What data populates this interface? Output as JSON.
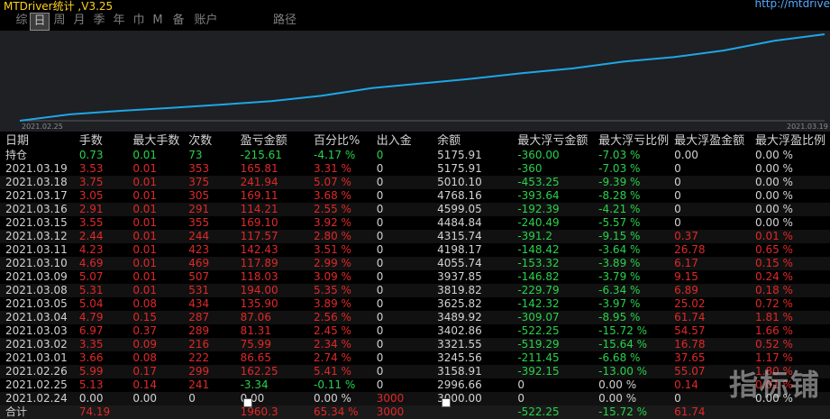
{
  "app": {
    "title": "MTDriver统计 ,V3.25",
    "link": "http://mtdrive"
  },
  "tabs": [
    {
      "label": "综"
    },
    {
      "label": "日",
      "active": true
    },
    {
      "label": "周"
    },
    {
      "label": "月"
    },
    {
      "label": "季"
    },
    {
      "label": "年"
    },
    {
      "label": "巾"
    },
    {
      "label": "M"
    },
    {
      "label": "备"
    },
    {
      "label": "账户"
    },
    {
      "label": "路径"
    }
  ],
  "chart_data": {
    "type": "line",
    "start_label": "2021.02.25",
    "end_label": "2021.03.19",
    "x": [
      "2021.02.25",
      "2021.02.26",
      "2021.03.01",
      "2021.03.02",
      "2021.03.03",
      "2021.03.04",
      "2021.03.05",
      "2021.03.08",
      "2021.03.09",
      "2021.03.10",
      "2021.03.11",
      "2021.03.12",
      "2021.03.15",
      "2021.03.16",
      "2021.03.17",
      "2021.03.18",
      "2021.03.19"
    ],
    "y": [
      2996.66,
      3158.91,
      3245.56,
      3321.55,
      3402.86,
      3489.92,
      3625.82,
      3819.82,
      3937.85,
      4055.74,
      4198.17,
      4315.74,
      4484.84,
      4599.05,
      4768.16,
      5010.1,
      5175.91
    ],
    "line_color": "#1ea6e6"
  },
  "table": {
    "headers": [
      "日期",
      "手数",
      "最大手数",
      "次数",
      "盈亏金额",
      "百分比%",
      "出入金",
      "余额",
      "最大浮亏金额",
      "最大浮亏比例",
      "最大浮盈金额",
      "最大浮盈比例"
    ],
    "position_row": [
      "持仓",
      "0.73",
      "0.01",
      "73",
      "-215.61",
      "-4.17 %",
      "0",
      "5175.91",
      "-360.00",
      "-7.03 %",
      "0.00",
      "0.00 %"
    ],
    "rows": [
      [
        "2021.03.19",
        "3.53",
        "0.01",
        "353",
        "165.81",
        "3.31 %",
        "0",
        "5175.91",
        "-360",
        "-7.03 %",
        "0",
        "0.00 %"
      ],
      [
        "2021.03.18",
        "3.75",
        "0.01",
        "375",
        "241.94",
        "5.07 %",
        "0",
        "5010.10",
        "-453.25",
        "-9.39 %",
        "0",
        "0.00 %"
      ],
      [
        "2021.03.17",
        "3.05",
        "0.01",
        "305",
        "169.11",
        "3.68 %",
        "0",
        "4768.16",
        "-393.64",
        "-8.28 %",
        "0",
        "0.00 %"
      ],
      [
        "2021.03.16",
        "2.91",
        "0.01",
        "291",
        "114.21",
        "2.55 %",
        "0",
        "4599.05",
        "-192.39",
        "-4.21 %",
        "0",
        "0.00 %"
      ],
      [
        "2021.03.15",
        "3.55",
        "0.01",
        "355",
        "169.10",
        "3.92 %",
        "0",
        "4484.84",
        "-240.49",
        "-5.57 %",
        "0",
        "0.00 %"
      ],
      [
        "2021.03.12",
        "2.44",
        "0.01",
        "244",
        "117.57",
        "2.80 %",
        "0",
        "4315.74",
        "-391.2",
        "-9.15 %",
        "0.37",
        "0.01 %"
      ],
      [
        "2021.03.11",
        "4.23",
        "0.01",
        "423",
        "142.43",
        "3.51 %",
        "0",
        "4198.17",
        "-148.42",
        "-3.64 %",
        "26.78",
        "0.65 %"
      ],
      [
        "2021.03.10",
        "4.69",
        "0.01",
        "469",
        "117.89",
        "2.99 %",
        "0",
        "4055.74",
        "-153.32",
        "-3.89 %",
        "6.17",
        "0.15 %"
      ],
      [
        "2021.03.09",
        "5.07",
        "0.01",
        "507",
        "118.03",
        "3.09 %",
        "0",
        "3937.85",
        "-146.82",
        "-3.79 %",
        "9.15",
        "0.24 %"
      ],
      [
        "2021.03.08",
        "5.31",
        "0.01",
        "531",
        "194.00",
        "5.35 %",
        "0",
        "3819.82",
        "-229.79",
        "-6.34 %",
        "6.89",
        "0.18 %"
      ],
      [
        "2021.03.05",
        "5.04",
        "0.08",
        "434",
        "135.90",
        "3.89 %",
        "0",
        "3625.82",
        "-142.32",
        "-3.97 %",
        "25.02",
        "0.72 %"
      ],
      [
        "2021.03.04",
        "4.79",
        "0.15",
        "287",
        "87.06",
        "2.56 %",
        "0",
        "3489.92",
        "-309.07",
        "-8.95 %",
        "61.74",
        "1.81 %"
      ],
      [
        "2021.03.03",
        "6.97",
        "0.37",
        "289",
        "81.31",
        "2.45 %",
        "0",
        "3402.86",
        "-522.25",
        "-15.72 %",
        "54.57",
        "1.66 %"
      ],
      [
        "2021.03.02",
        "3.35",
        "0.09",
        "216",
        "75.99",
        "2.34 %",
        "0",
        "3321.55",
        "-519.29",
        "-15.64 %",
        "16.78",
        "0.52 %"
      ],
      [
        "2021.03.01",
        "3.66",
        "0.08",
        "222",
        "86.65",
        "2.74 %",
        "0",
        "3245.56",
        "-211.45",
        "-6.68 %",
        "37.65",
        "1.17 %"
      ],
      [
        "2021.02.26",
        "5.99",
        "0.17",
        "299",
        "162.25",
        "5.41 %",
        "0",
        "3158.91",
        "-392.15",
        "-13.00 %",
        "55.07",
        "1.80 %"
      ],
      [
        "2021.02.25",
        "5.13",
        "0.14",
        "241",
        "-3.34",
        "-0.11 %",
        "0",
        "2996.66",
        "0",
        "0.00 %",
        "0.14",
        "0.01 %"
      ],
      [
        "2021.02.24",
        "0.00",
        "0.00",
        "0",
        "0.00",
        "0.00 %",
        "3000",
        "3000.00",
        "0",
        "0.00 %",
        "0",
        "0.00 %"
      ]
    ],
    "total_row": [
      "合计",
      "74.19",
      "",
      "",
      "1960.3",
      "65.34 %",
      "3000",
      "",
      "-522.25",
      "-15.72 %",
      "61.74",
      ""
    ]
  },
  "watermark": "指标铺"
}
